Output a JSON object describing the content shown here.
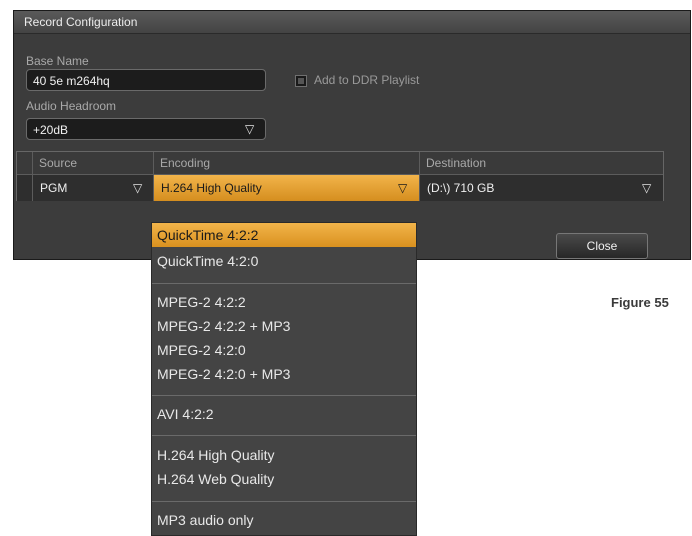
{
  "dialog": {
    "title": "Record Configuration",
    "base_name_label": "Base Name",
    "base_name_value": "40 5e m264hq",
    "add_ddr_label": "Add to DDR Playlist",
    "audio_headroom_label": "Audio Headroom",
    "audio_headroom_value": "+20dB",
    "close_label": "Close"
  },
  "table": {
    "headers": [
      "Source",
      "Encoding",
      "Destination"
    ],
    "row": {
      "source": "PGM",
      "encoding": "H.264 High Quality",
      "destination": "(D:\\) 710 GB"
    }
  },
  "dropdown": {
    "items": [
      "QuickTime 4:2:2",
      "QuickTime 4:2:0",
      "MPEG-2 4:2:2",
      "MPEG-2 4:2:2 + MP3",
      "MPEG-2 4:2:0",
      "MPEG-2 4:2:0 + MP3",
      "AVI 4:2:2",
      "H.264 High Quality",
      "H.264 Web Quality",
      "MP3 audio only"
    ],
    "selected_index": 0
  },
  "figure_label": "Figure 55",
  "icons": {
    "dropdown_arrow": "triangle-down-icon"
  },
  "colors": {
    "accent": "#e8a534",
    "panel": "#3c3c3c",
    "field": "#1c1c1c"
  }
}
